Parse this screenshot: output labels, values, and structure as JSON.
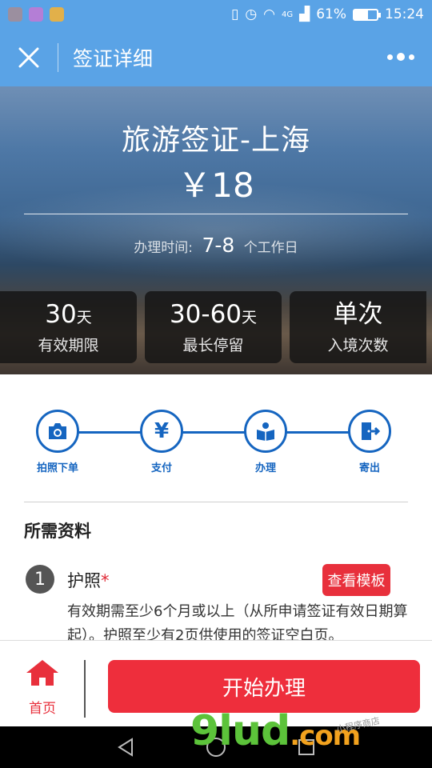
{
  "status_bar": {
    "signal": "4G",
    "battery": "61%",
    "battery_level": 0.61,
    "time": "15:24"
  },
  "nav": {
    "title": "签证详细",
    "close_icon": "close-icon",
    "more_icon": "more-icon"
  },
  "hero": {
    "title": "旅游签证-上海",
    "price": "￥18",
    "time_label": "办理时间:",
    "time_value": "7-8",
    "time_unit": "个工作日",
    "stats": [
      {
        "value": "30",
        "unit": "天",
        "label": "有效期限"
      },
      {
        "value": "30-60",
        "unit": "天",
        "label": "最长停留"
      },
      {
        "value": "单次",
        "unit": "",
        "label": "入境次数"
      }
    ]
  },
  "steps": [
    {
      "label": "拍照下单",
      "icon": "camera-icon"
    },
    {
      "label": "支付",
      "icon": "yen-icon"
    },
    {
      "label": "办理",
      "icon": "book-icon"
    },
    {
      "label": "寄出",
      "icon": "exit-door-icon"
    }
  ],
  "materials": {
    "title": "所需资料",
    "items": [
      {
        "number": "1",
        "title": "护照",
        "required_mark": "*",
        "button": "查看模板",
        "description": "有效期需至少6个月或以上（从所申请签证有效日期算起）。护照至少有2页供使用的签证空白页。"
      }
    ]
  },
  "bottom_bar": {
    "home_label": "首页",
    "start_button": "开始办理"
  },
  "watermark": {
    "brand": "9lud",
    "domain": ".com",
    "small_text": "小程序商店"
  },
  "colors": {
    "primary_blue": "#5aa3e6",
    "step_blue": "#1565c0",
    "accent_red": "#e8303c"
  }
}
